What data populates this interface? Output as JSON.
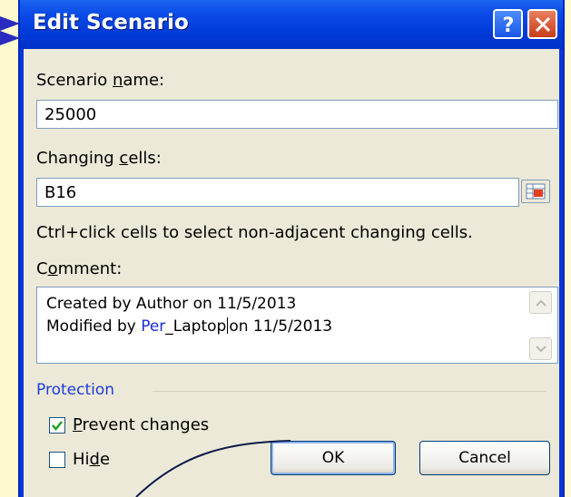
{
  "dialog": {
    "title": "Edit Scenario",
    "help_label": "?",
    "close_label": "✕"
  },
  "scenario_name": {
    "label_pre": "Scenario ",
    "label_u": "n",
    "label_post": "ame:",
    "value": "25000"
  },
  "changing_cells": {
    "label_pre": "Changing ",
    "label_u": "c",
    "label_post": "ells:",
    "value": "B16",
    "hint": "Ctrl+click cells to select non-adjacent changing cells."
  },
  "comment": {
    "label_pre": "C",
    "label_u": "o",
    "label_post": "mment:",
    "line1": "Created by Author on 11/5/2013",
    "line2_a": "Modified by ",
    "line2_b": "Per",
    "line2_c": "_Laptop",
    "line2_d": "on 11/5/2013"
  },
  "protection": {
    "group_label": "Protection",
    "prevent": {
      "label_u": "P",
      "label_rest": "revent changes",
      "checked": true
    },
    "hide": {
      "label_pre": "Hi",
      "label_u": "d",
      "label_post": "e",
      "checked": false
    }
  },
  "buttons": {
    "ok": "OK",
    "cancel": "Cancel"
  },
  "colors": {
    "title_bar": "#0a4ae6",
    "dialog_face": "#ece9d8",
    "page_background": "#fffbd0",
    "group_label": "#1c3dd8",
    "highlight_text": "#1a2cd6"
  }
}
